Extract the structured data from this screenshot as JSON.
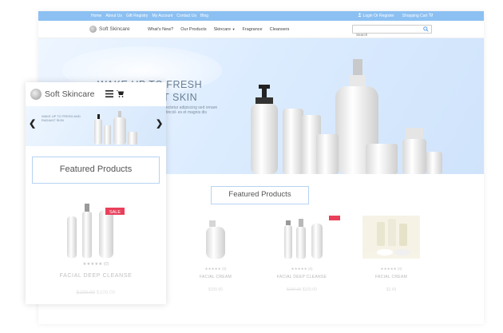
{
  "topbar": {
    "links": [
      "Home",
      "About Us",
      "Gift Registry",
      "My Account",
      "Contact Us",
      "Blog"
    ],
    "login": "Login Or Register",
    "cart": "Shopping Cart"
  },
  "brand": "Soft Skincare",
  "nav": {
    "items": [
      "What's New?",
      "Our Products",
      "Skincare",
      "Fragrance",
      "Cleansers"
    ],
    "search_placeholder": "Search"
  },
  "hero": {
    "headline": "WAKE UP TO FRESH AND RADIANT SKIN",
    "body": "ectetur adipiscing sed ornare tincid- es et magnis dis"
  },
  "featured_title": "Featured Products",
  "products": [
    {
      "name": "FACIAL CREAM",
      "rating": "(0)",
      "price": "$100.00",
      "old_price": "",
      "sale": ""
    },
    {
      "name": "FACIAL DEEP CLEANSE",
      "rating": "(0)",
      "price": "$100.00",
      "old_price": "$199.00",
      "sale": "SALE"
    },
    {
      "name": "FACIAL CREAM",
      "rating": "(0)",
      "price": "$3.49",
      "old_price": "",
      "sale": ""
    }
  ],
  "mobile": {
    "hero_text": "WAKE UP TO FRESH AND RADIANT SKIN",
    "product": {
      "name": "FACIAL DEEP CLEANSE",
      "rating": "(0)",
      "price": "$100.00",
      "old_price": "$199.00",
      "sale": "SALE"
    }
  },
  "colors": {
    "topbar": "#8cc0f2",
    "accent_border": "#b7d3f3",
    "sale": "#e8405b"
  }
}
